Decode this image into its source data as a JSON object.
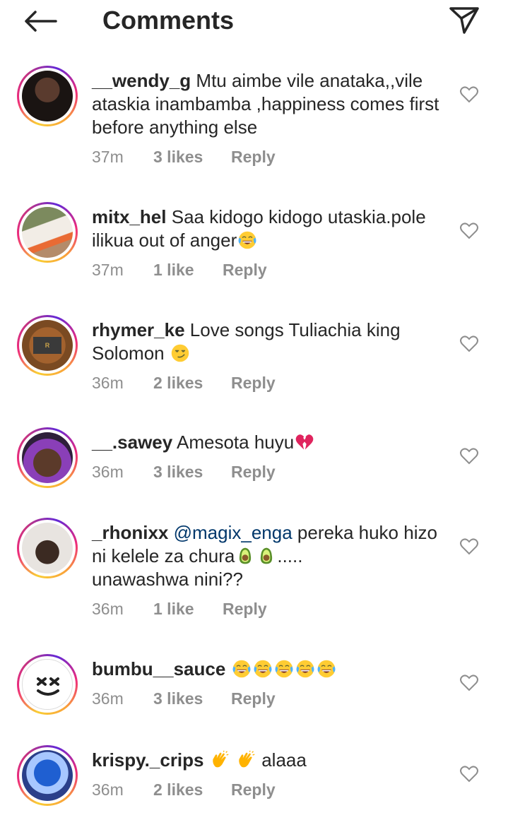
{
  "header": {
    "title": "Comments",
    "back_icon": "arrow-left-icon",
    "share_icon": "send-paper-plane-icon"
  },
  "colors": {
    "text": "#262626",
    "meta": "#8e8e8e",
    "mention": "#00376b",
    "ring": [
      "#f9ce34",
      "#ee2a7b",
      "#6228d7"
    ]
  },
  "comments": [
    {
      "username": "__wendy_g",
      "text": "Mtu aimbe vile anataka,,vile ataskia inambamba ,happiness comes first before anything else",
      "time": "37m",
      "likes": "3 likes",
      "reply": "Reply"
    },
    {
      "username": "mitx_hel",
      "text": "Saa kidogo kidogo utaskia.pole ilikua out of anger",
      "emoji": [
        "laughing-crying-emoji"
      ],
      "time": "37m",
      "likes": "1 like",
      "reply": "Reply"
    },
    {
      "username": "rhymer_ke",
      "text": "Love songs Tuliachia king Solomon",
      "emoji": [
        "smirk-emoji"
      ],
      "time": "36m",
      "likes": "2 likes",
      "reply": "Reply"
    },
    {
      "username": "__.sawey",
      "text": "Amesota huyu",
      "emoji": [
        "broken-heart-emoji"
      ],
      "time": "36m",
      "likes": "3 likes",
      "reply": "Reply"
    },
    {
      "username": "_rhonixx",
      "mention": "@magix_enga",
      "text": "pereka huko hizo ni kelele za chura",
      "text_after": ".....\nunawashwa nini??",
      "emoji": [
        "avocado-emoji",
        "avocado-emoji"
      ],
      "time": "36m",
      "likes": "1 like",
      "reply": "Reply"
    },
    {
      "username": "bumbu__sauce",
      "text": "",
      "emoji": [
        "laughing-crying-emoji",
        "laughing-crying-emoji",
        "laughing-crying-emoji",
        "laughing-crying-emoji",
        "laughing-crying-emoji"
      ],
      "time": "36m",
      "likes": "3 likes",
      "reply": "Reply"
    },
    {
      "username": "krispy._crips",
      "text": "alaaa",
      "emoji": [
        "clapping-hands-emoji",
        "clapping-hands-emoji"
      ],
      "time": "36m",
      "likes": "2 likes",
      "reply": "Reply"
    }
  ]
}
